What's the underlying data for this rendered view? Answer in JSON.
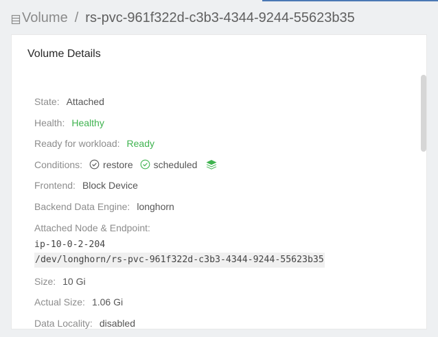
{
  "breadcrumb": {
    "parent": "Volume",
    "separator": "/",
    "current": "rs-pvc-961f322d-c3b3-4344-9244-55623b35"
  },
  "card": {
    "title": "Volume Details"
  },
  "details": {
    "state": {
      "label": "State:",
      "value": "Attached"
    },
    "health": {
      "label": "Health:",
      "value": "Healthy"
    },
    "ready": {
      "label": "Ready for workload:",
      "value": "Ready"
    },
    "conditions": {
      "label": "Conditions:",
      "items": [
        "restore",
        "scheduled"
      ]
    },
    "frontend": {
      "label": "Frontend:",
      "value": "Block Device"
    },
    "backend": {
      "label": "Backend Data Engine:",
      "value": "longhorn"
    },
    "attached": {
      "label": "Attached Node & Endpoint:",
      "node": "ip-10-0-2-204",
      "endpoint": "/dev/longhorn/rs-pvc-961f322d-c3b3-4344-9244-55623b35"
    },
    "size": {
      "label": "Size:",
      "value": "10 Gi"
    },
    "actual_size": {
      "label": "Actual Size:",
      "value": "1.06 Gi"
    },
    "data_locality": {
      "label": "Data Locality:",
      "value": "disabled"
    }
  },
  "colors": {
    "healthy": "#3fb34f",
    "accent": "#4a78b4"
  },
  "icons": {
    "breadcrumb": "volume-list-icon",
    "condition": "check-circle-icon",
    "stack": "layers-icon"
  }
}
